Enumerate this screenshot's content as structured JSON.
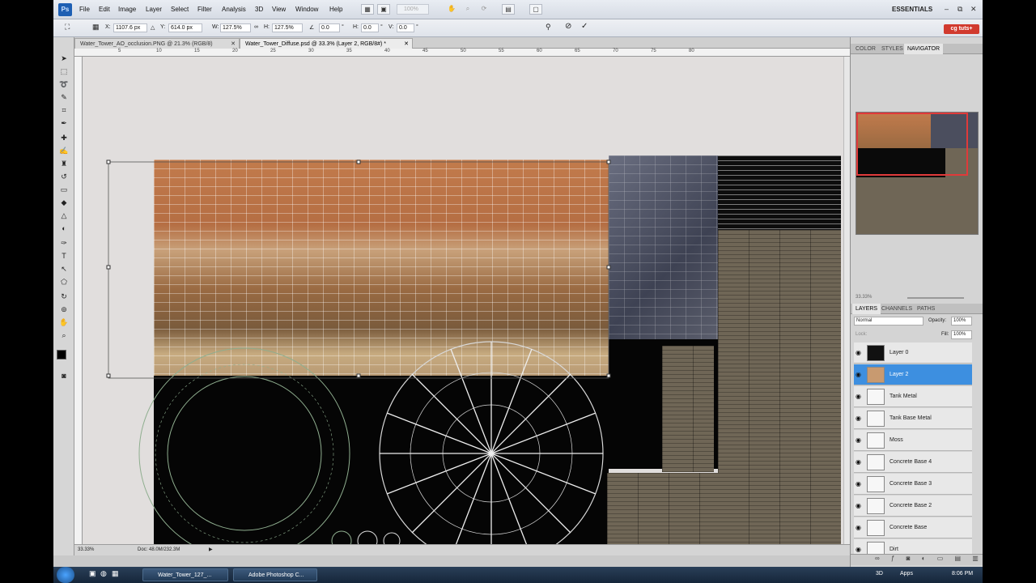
{
  "app": {
    "logo": "Ps",
    "menu": [
      "File",
      "Edit",
      "Image",
      "Layer",
      "Select",
      "Filter",
      "Analysis",
      "3D",
      "View",
      "Window",
      "Help"
    ],
    "zoom_box": "100%",
    "workspace": "ESSENTIALS",
    "window_controls": [
      "–",
      "⧉",
      "✕"
    ]
  },
  "options": {
    "x_label": "X:",
    "x_value": "1107.6 px",
    "y_label": "Y:",
    "y_value": "614.0 px",
    "w_label": "W:",
    "w_value": "127.5%",
    "h_label": "H:",
    "h_value": "127.5%",
    "angle_value": "0.0",
    "hskew_label": "H:",
    "hskew_value": "0.0",
    "vskew_label": "V:",
    "vskew_value": "0.0",
    "degree": "°",
    "badge": "cg tuts+"
  },
  "tabs": [
    {
      "label": "Water_Tower_AO_occlusion.PNG @ 21.3% (RGB/8)",
      "close": "✕"
    },
    {
      "label": "Water_Tower_Diffuse.psd @ 33.3% (Layer 2, RGB/8#) *",
      "close": "✕"
    }
  ],
  "ruler_ticks": [
    "5",
    "10",
    "15",
    "20",
    "25",
    "30",
    "35",
    "40",
    "45",
    "50",
    "55",
    "60",
    "65",
    "70",
    "75",
    "80"
  ],
  "status": {
    "zoom": "33.33%",
    "doc": "Doc: 48.0M/232.3M"
  },
  "panels": {
    "top_tabs": [
      "COLOR",
      "STYLES",
      "NAVIGATOR"
    ],
    "nav_zoom": "33.33%",
    "layer_tabs": [
      "LAYERS",
      "CHANNELS",
      "PATHS"
    ],
    "blend_mode": "Normal",
    "opacity_label": "Opacity:",
    "opacity_value": "100%",
    "lock_label": "Lock:",
    "fill_label": "Fill:",
    "fill_value": "100%",
    "layers": [
      {
        "name": "Layer 0",
        "selected": false
      },
      {
        "name": "Layer 2",
        "selected": true
      },
      {
        "name": "Tank Metal",
        "selected": false
      },
      {
        "name": "Tank Base Metal",
        "selected": false
      },
      {
        "name": "Moss",
        "selected": false
      },
      {
        "name": "Concrete Base 4",
        "selected": false
      },
      {
        "name": "Concrete Base 3",
        "selected": false
      },
      {
        "name": "Concrete Base 2",
        "selected": false
      },
      {
        "name": "Concrete Base",
        "selected": false
      },
      {
        "name": "Dirt",
        "selected": false
      }
    ]
  },
  "taskbar": {
    "items": [
      "Water_Tower_127_...",
      "Adobe Photoshop C..."
    ],
    "tray_3d": "3D",
    "tray_apps": "Apps",
    "clock": "8:06 PM"
  },
  "colors": {
    "selection_blue": "#3d8fe0",
    "accent_red": "#d13a2e"
  }
}
